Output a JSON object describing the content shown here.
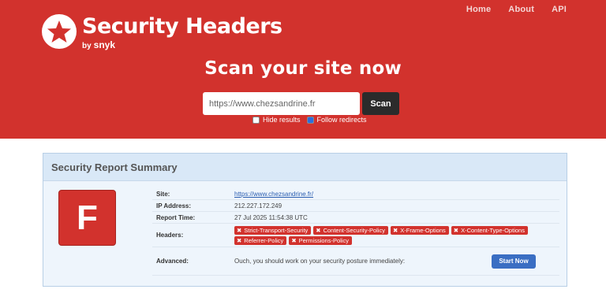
{
  "nav": {
    "items": [
      "Home",
      "About",
      "API"
    ]
  },
  "logo": {
    "title": "Security Headers",
    "by": "by",
    "brand": "snyk"
  },
  "scan": {
    "title": "Scan your site now",
    "input_value": "https://www.chezsandrine.fr",
    "button_label": "Scan",
    "hide_results_label": "Hide results",
    "hide_results_checked": false,
    "follow_redirects_label": "Follow redirects",
    "follow_redirects_checked": true
  },
  "report": {
    "title": "Security Report Summary",
    "grade": "F",
    "grade_color": "#d2322d",
    "site_label": "Site:",
    "site_value": "https://www.chezsandrine.fr/",
    "ip_label": "IP Address:",
    "ip_value": "212.227.172.249",
    "time_label": "Report Time:",
    "time_value": "27 Jul 2025 11:54:38 UTC",
    "headers_label": "Headers:",
    "headers": [
      "Strict-Transport-Security",
      "Content-Security-Policy",
      "X-Frame-Options",
      "X-Content-Type-Options",
      "Referrer-Policy",
      "Permissions-Policy"
    ],
    "advanced_label": "Advanced:",
    "advanced_text": "Ouch, you should work on your security posture immediately:",
    "start_button": "Start Now"
  },
  "colors": {
    "brand": "#d2322d",
    "accent": "#3a6ec3",
    "panel": "#eef5fc"
  }
}
